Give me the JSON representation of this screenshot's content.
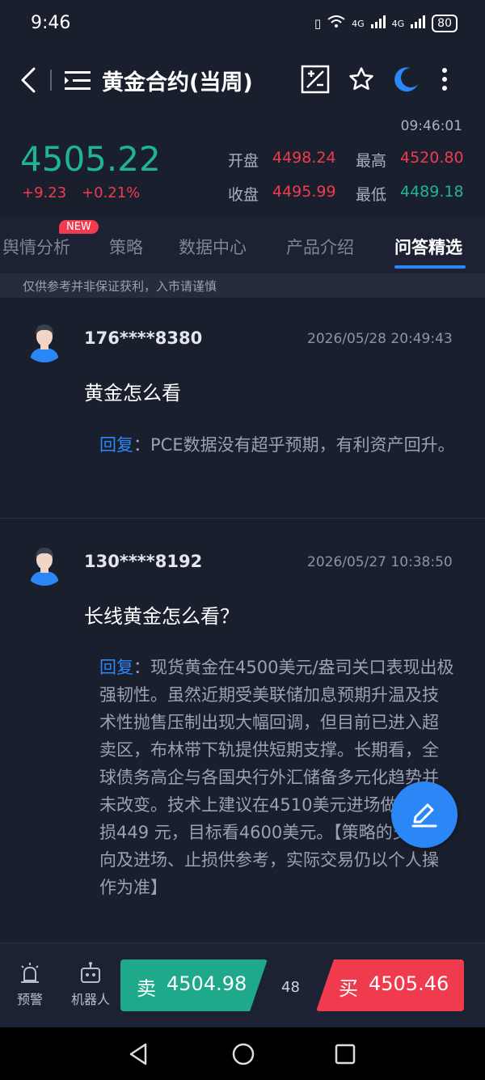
{
  "status_bar": {
    "time": "9:46",
    "network": "4G",
    "network2": "4G",
    "battery": "80"
  },
  "header": {
    "title": "黄金合约(当周)"
  },
  "quote": {
    "time": "09:46:01",
    "price": "4505.22",
    "change": "+9.23",
    "change_pct": "+0.21%",
    "open_label": "开盘",
    "open": "4498.24",
    "high_label": "最高",
    "high": "4520.80",
    "close_label": "收盘",
    "close": "4495.99",
    "low_label": "最低",
    "low": "4489.18",
    "colors": {
      "up": "#f03b4e",
      "down": "#1fb496"
    }
  },
  "tabs": [
    {
      "label": "舆情分析",
      "badge": "NEW"
    },
    {
      "label": "策略"
    },
    {
      "label": "数据中心"
    },
    {
      "label": "产品介绍"
    },
    {
      "label": "问答精选",
      "active": true
    }
  ],
  "disclaimer": "仅供参考并非保证获利，入市请谨慎",
  "qa": [
    {
      "user": "176****8380",
      "date": "2026/05/28 20:49:43",
      "question": "黄金怎么看",
      "reply_label": "回复",
      "answer": "：PCE数据没有超乎预期，有利资产回升。"
    },
    {
      "user": "130****8192",
      "date": "2026/05/27 10:38:50",
      "question": "长线黄金怎么看？",
      "reply_label": "回复",
      "answer": "：现货黄金在4500美元/盎司关口表现出极强韧性。虽然近期受美联储加息预期升温及技术性抛售压制出现大幅回调，但目前已进入超卖区，布林带下轨提供短期支撑。长期看，全球债务高企与各国央行外汇储备多元化趋势并未改变。技术上建议在4510美元进场做多，止损449 元，目标看4600美元。【策略的交易方向及进场、止损供参考，实际交易仍以个人操作为准】"
    }
  ],
  "toolbar": {
    "alert_label": "预警",
    "robot_label": "机器人",
    "sell_label": "卖",
    "sell_price": "4504.98",
    "spread": "48",
    "buy_label": "买",
    "buy_price": "4505.46"
  }
}
